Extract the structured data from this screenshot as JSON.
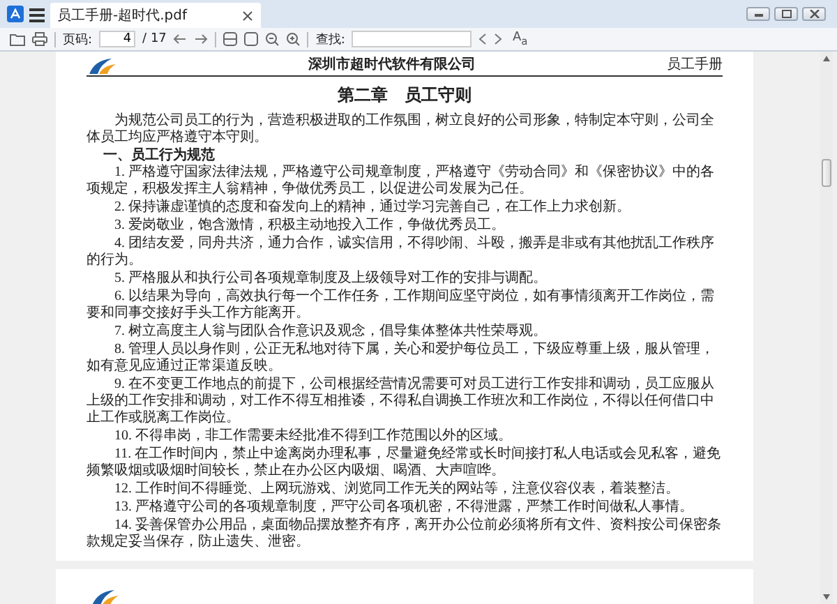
{
  "window": {
    "tab_title": "员工手册-超时代.pdf"
  },
  "toolbar": {
    "page_label": "页码:",
    "page_value": "4",
    "page_total": "/ 17",
    "find_label": "查找:",
    "find_option": "A$_{a}$"
  },
  "document": {
    "header": {
      "company": "深圳市超时代软件有限公司",
      "right": "员工手册"
    },
    "title": "第二章　员工守则",
    "paragraphs": [
      {
        "kind": "body",
        "text": "为规范公司员工的行为，营造积极进取的工作氛围，树立良好的公司形象，特制定本守则，公司全体员工均应严格遵守本守则。"
      },
      {
        "kind": "heading",
        "text": "一、员工行为规范"
      },
      {
        "kind": "body",
        "text": "1. 严格遵守国家法律法规，严格遵守公司规章制度，严格遵守《劳动合同》和《保密协议》中的各项规定，积极发挥主人翁精神，争做优秀员工，以促进公司发展为己任。"
      },
      {
        "kind": "body",
        "text": "2. 保持谦虚谨慎的态度和奋发向上的精神，通过学习完善自己，在工作上力求创新。"
      },
      {
        "kind": "body",
        "text": "3. 爱岗敬业，饱含激情，积极主动地投入工作，争做优秀员工。"
      },
      {
        "kind": "body",
        "text": "4. 团结友爱，同舟共济，通力合作，诚实信用，不得吵闹、斗殴，搬弄是非或有其他扰乱工作秩序的行为。"
      },
      {
        "kind": "body",
        "text": "5. 严格服从和执行公司各项规章制度及上级领导对工作的安排与调配。"
      },
      {
        "kind": "body",
        "text": "6. 以结果为导向，高效执行每一个工作任务，工作期间应坚守岗位，如有事情须离开工作岗位，需要和同事交接好手头工作方能离开。"
      },
      {
        "kind": "body",
        "text": "7. 树立高度主人翁与团队合作意识及观念，倡导集体整体共性荣辱观。"
      },
      {
        "kind": "body",
        "text": "8. 管理人员以身作则，公正无私地对待下属，关心和爱护每位员工，下级应尊重上级，服从管理，如有意见应通过正常渠道反映。"
      },
      {
        "kind": "body",
        "text": "9. 在不变更工作地点的前提下，公司根据经营情况需要可对员工进行工作安排和调动，员工应服从上级的工作安排和调动，对工作不得互相推诿，不得私自调换工作班次和工作岗位，不得以任何借口中止工作或脱离工作岗位。"
      },
      {
        "kind": "body",
        "text": "10. 不得串岗，非工作需要未经批准不得到工作范围以外的区域。"
      },
      {
        "kind": "body",
        "text": "11. 在工作时间内，禁止中途离岗办理私事，尽量避免经常或长时间接打私人电话或会见私客，避免频繁吸烟或吸烟时间较长，禁止在办公区内吸烟、喝酒、大声喧哗。"
      },
      {
        "kind": "body",
        "text": "12. 工作时间不得睡觉、上网玩游戏、浏览同工作无关的网站等，注意仪容仪表，着装整洁。"
      },
      {
        "kind": "body",
        "text": "13. 严格遵守公司的各项规章制度，严守公司各项机密，不得泄露，严禁工作时间做私人事情。"
      },
      {
        "kind": "body",
        "text": "14. 妥善保管办公用品，桌面物品摆放整齐有序，离开办公位前必须将所有文件、资料按公司保密条款规定妥当保存，防止遗失、泄密。"
      }
    ]
  }
}
